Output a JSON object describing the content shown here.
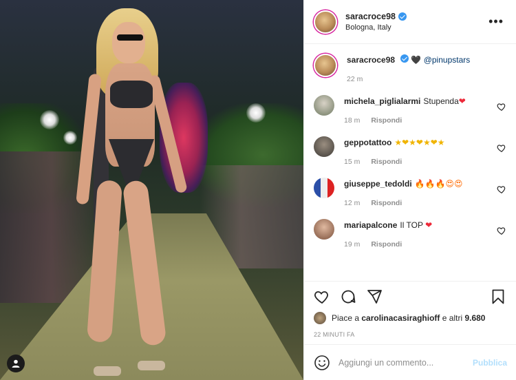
{
  "post": {
    "author": "saracroce98",
    "location": "Bologna, Italy",
    "caption_tag": "@pinupstars",
    "caption_time": "22 m",
    "time_ago": "22 MINUTI FA"
  },
  "comments": [
    {
      "user": "michela_piglialarmi",
      "text": "Stupenda",
      "emoji": "❤",
      "time": "18 m",
      "reply": "Rispondi"
    },
    {
      "user": "geppotattoo",
      "text": "",
      "emoji": "★❤★❤★❤★",
      "time": "15 m",
      "reply": "Rispondi"
    },
    {
      "user": "giuseppe_tedoldi",
      "text": "",
      "emoji": "🔥🔥🔥😍😍",
      "time": "12 m",
      "reply": "Rispondi"
    },
    {
      "user": "mariapalcone",
      "text": "Il TOP",
      "emoji": "❤",
      "time": "19 m",
      "reply": "Rispondi"
    }
  ],
  "likes": {
    "prefix": "Piace a",
    "user": "carolinacasiraghioff",
    "suffix": "e altri",
    "count": "9.680"
  },
  "composer": {
    "placeholder": "Aggiungi un commento...",
    "post_label": "Pubblica"
  },
  "icons": {
    "more": "more-options-icon",
    "like": "heart-icon",
    "comment": "comment-icon",
    "share": "share-icon",
    "save": "bookmark-icon",
    "emoji": "emoji-icon",
    "user": "user-icon"
  },
  "colors": {
    "verified": "#3897f0",
    "link": "#00376b",
    "muted": "#8e8e8e",
    "post_disabled": "#b2dffc"
  }
}
